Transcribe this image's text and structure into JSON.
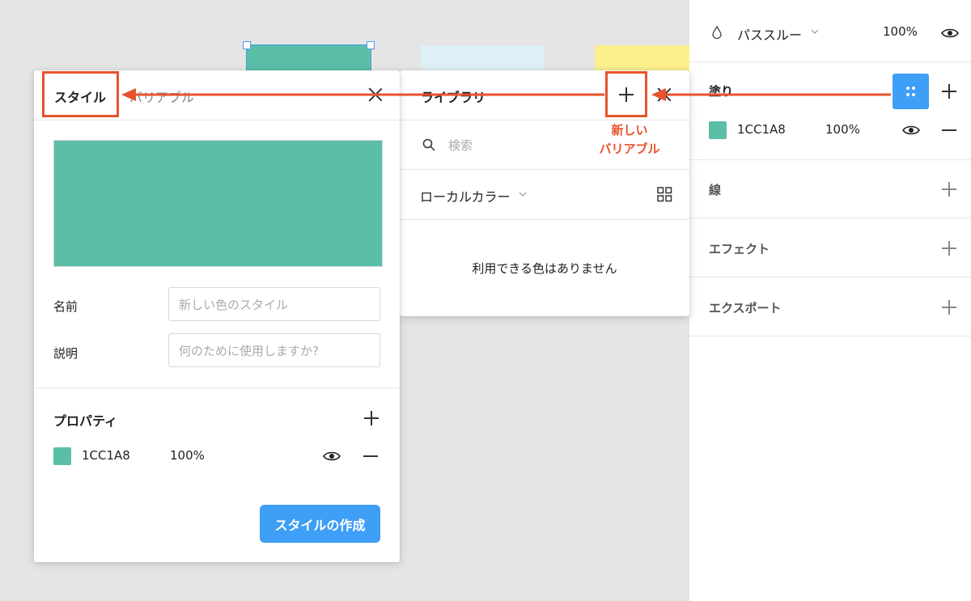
{
  "right_panel": {
    "blend_mode": "パススルー",
    "layer_opacity": "100%",
    "fill": {
      "title": "塗り",
      "hex": "1CC1A8",
      "opacity": "100%"
    },
    "stroke_title": "線",
    "effects_title": "エフェクト",
    "export_title": "エクスポート"
  },
  "style_popover": {
    "tab_style": "スタイル",
    "tab_variables": "バリアブル",
    "name_label": "名前",
    "name_placeholder": "新しい色のスタイル",
    "desc_label": "説明",
    "desc_placeholder": "何のために使用しますか?",
    "properties_title": "プロパティ",
    "property_hex": "1CC1A8",
    "property_opacity": "100%",
    "create_button": "スタイルの作成"
  },
  "library_popover": {
    "title": "ライブラリ",
    "search_placeholder": "検索",
    "local_colors": "ローカルカラー",
    "empty_message": "利用できる色はありません"
  },
  "annotation": {
    "label_line1": "新しい",
    "label_line2": "バリアブル"
  },
  "colors": {
    "fill": "#5bbfa8",
    "accent": "#3f9ef5",
    "annotation": "#e8532e"
  }
}
